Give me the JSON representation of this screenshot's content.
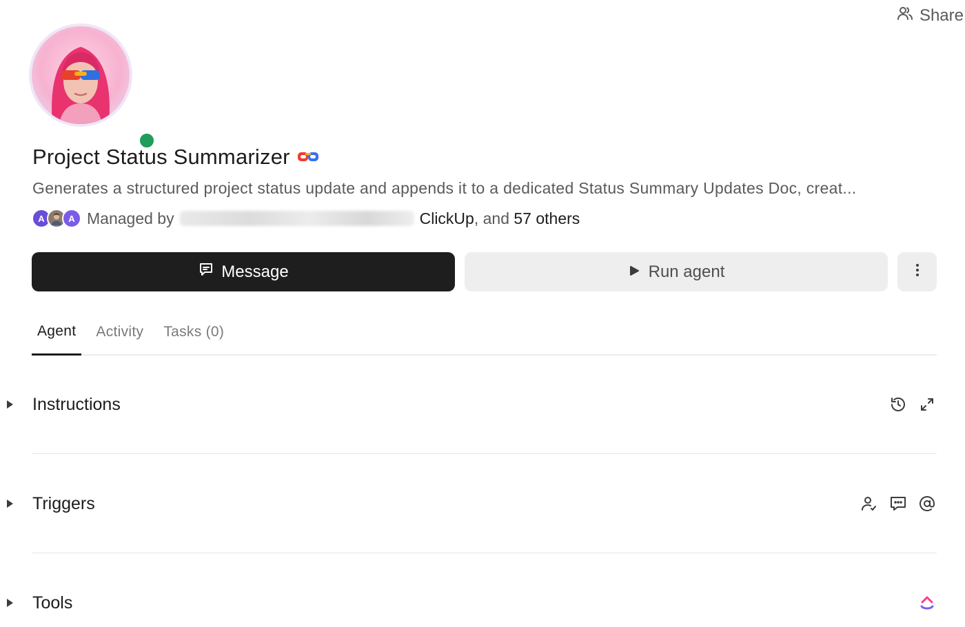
{
  "header": {
    "share_label": "Share",
    "share_icon": "share-people-icon"
  },
  "agent": {
    "avatar_icon": "agent-avatar",
    "status": "online",
    "status_color": "#1f9d5a",
    "title": "Project Status Summarizer",
    "title_badge_icon": "ai-mask-icon",
    "description": "Generates a structured project status update and appends it to a dedicated Status Summary Updates Doc, creat...",
    "managed": {
      "avatar_initials": [
        "A",
        "",
        "A"
      ],
      "prefix": "Managed by",
      "org": "ClickUp",
      "separator": ", and",
      "others": "57 others"
    }
  },
  "actions": {
    "message_label": "Message",
    "message_icon": "chat-icon",
    "run_label": "Run agent",
    "run_icon": "play-icon",
    "more_icon": "more-vertical-icon",
    "primary_color": "#1e1e1e"
  },
  "tabs": [
    {
      "label": "Agent",
      "active": true
    },
    {
      "label": "Activity",
      "active": false
    },
    {
      "label": "Tasks (0)",
      "active": false
    }
  ],
  "sections": {
    "instructions": {
      "label": "Instructions",
      "icons": [
        "history-icon",
        "expand-icon"
      ]
    },
    "triggers": {
      "label": "Triggers",
      "icons": [
        "assign-user-icon",
        "comment-icon",
        "mention-icon"
      ]
    },
    "tools": {
      "label": "Tools",
      "icons": [
        "clickup-logo-icon"
      ]
    }
  }
}
